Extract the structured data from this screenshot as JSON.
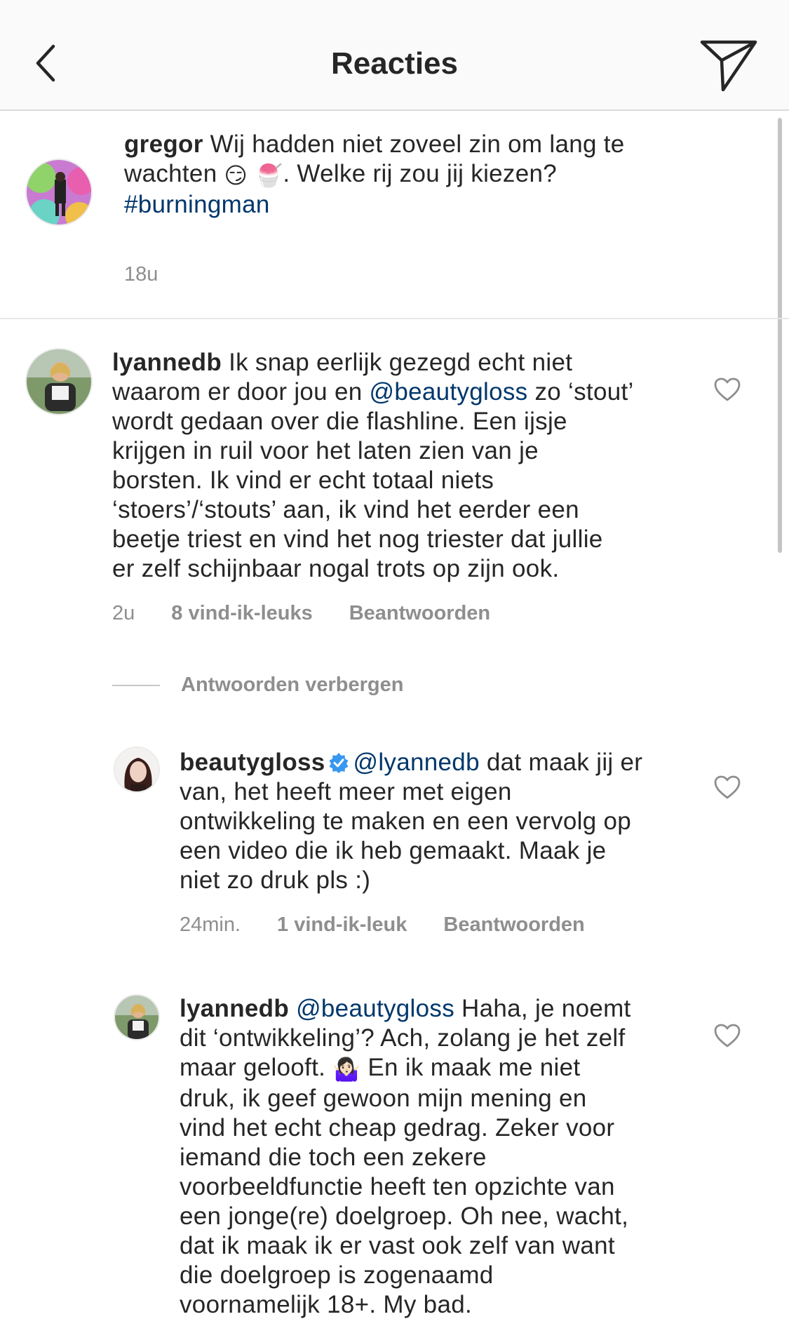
{
  "header": {
    "title": "Reacties"
  },
  "caption": {
    "username": "gregor",
    "text_line1": " Wij hadden niet zoveel zin om lang te",
    "text_line2a": "wachten ",
    "emoji1": "😏",
    "emoji2": "🍧",
    "text_line2b": ". Welke rij zou jij kiezen?",
    "hashtag": "#burningman",
    "time": "18u"
  },
  "comment1": {
    "username": "lyannedb",
    "line1": " Ik snap eerlijk gezegd echt niet",
    "line2a": "waarom er door jou en ",
    "mention": "@beautygloss",
    "line2b": " zo ‘stout’",
    "line3": "wordt gedaan over die flashline. Een ijsje",
    "line4": "krijgen in ruil voor het laten zien van je",
    "line5": "borsten. Ik vind er echt totaal niets",
    "line6": "‘stoers’/‘stouts’ aan, ik vind het eerder een",
    "line7": "beetje triest en vind het nog triester dat jullie",
    "line8": "er zelf schijnbaar nogal trots op zijn ook.",
    "time": "2u",
    "likes": "8 vind-ik-leuks",
    "reply": "Beantwoorden"
  },
  "hide_replies": "Antwoorden verbergen",
  "reply1": {
    "username": "beautygloss",
    "mention": "@lyannedb",
    "line1b": " dat maak jij er",
    "line2": "van, het heeft meer met eigen",
    "line3": "ontwikkeling te maken en een vervolg op",
    "line4": "een video die ik heb gemaakt. Maak je",
    "line5": "niet zo druk pls :)",
    "time": "24min.",
    "likes": "1 vind-ik-leuk",
    "reply": "Beantwoorden"
  },
  "reply2": {
    "username": "lyannedb",
    "mention": "@beautygloss",
    "line1b": " Haha, je noemt",
    "line2": "dit ‘ontwikkeling’? Ach, zolang je het zelf",
    "line3a": "maar gelooft. ",
    "emoji": "🤷🏻‍♀️",
    "line3b": " En ik maak me niet",
    "line4": "druk, ik geef gewoon mijn mening en",
    "line5": "vind het echt cheap gedrag. Zeker voor",
    "line6": "iemand die toch een zekere",
    "line7": "voorbeeldfunctie heeft ten opzichte van",
    "line8": "een jonge(re) doelgroep. Oh nee, wacht,",
    "line9": "dat ik maak ik er vast ook zelf van want",
    "line10": "die doelgroep is zogenaamd",
    "line11": "voornamelijk 18+. My bad."
  },
  "icons": {
    "back": "chevron-left-icon",
    "share": "paper-plane-icon",
    "like": "heart-outline-icon",
    "verified": "verified-badge-icon"
  },
  "colors": {
    "link": "#00376b",
    "verified": "#3897f0",
    "meta": "#8e8e8e"
  }
}
